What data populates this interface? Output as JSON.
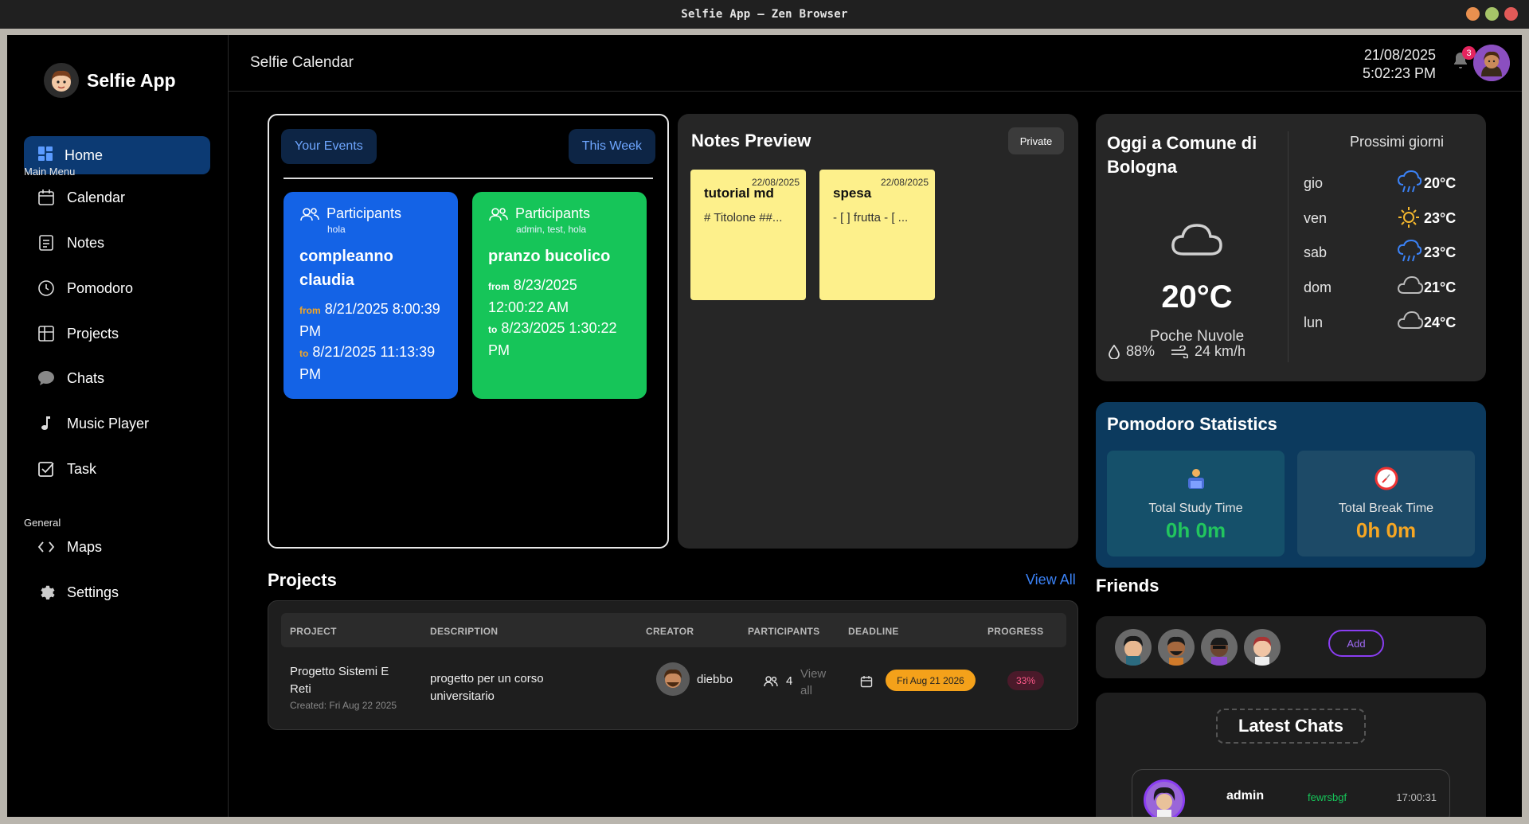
{
  "window": {
    "title": "Selfie App — Zen Browser"
  },
  "app": {
    "name": "Selfie App",
    "page_title": "Selfie Calendar"
  },
  "header": {
    "date": "21/08/2025",
    "time": "5:02:23 PM",
    "notifications": "3"
  },
  "sidebar": {
    "home": "Home",
    "main_menu_label": "Main Menu",
    "main_items": [
      {
        "label": "Calendar",
        "icon": "calendar-icon"
      },
      {
        "label": "Notes",
        "icon": "notes-icon"
      },
      {
        "label": "Pomodoro",
        "icon": "clock-icon"
      },
      {
        "label": "Projects",
        "icon": "projects-icon"
      },
      {
        "label": "Chats",
        "icon": "chat-icon"
      },
      {
        "label": "Music Player",
        "icon": "music-icon"
      },
      {
        "label": "Task",
        "icon": "task-icon"
      }
    ],
    "general_label": "General",
    "general_items": [
      {
        "label": "Maps",
        "icon": "code-icon"
      },
      {
        "label": "Settings",
        "icon": "gear-icon"
      }
    ]
  },
  "events": {
    "your_events": "Your Events",
    "this_week": "This Week",
    "items": [
      {
        "participants_label": "Participants",
        "participants": "hola",
        "title": "compleanno claudia",
        "from_label": "from",
        "from": "8/21/2025 8:00:39 PM",
        "to_label": "to",
        "to": "8/21/2025 11:13:39 PM",
        "color": "#1463e6"
      },
      {
        "participants_label": "Participants",
        "participants": "admin, test, hola",
        "title": "pranzo bucolico",
        "from_label": "from",
        "from": "8/23/2025 12:00:22 AM",
        "to_label": "to",
        "to": "8/23/2025 1:30:22 PM",
        "color": "#16c559"
      }
    ]
  },
  "notes": {
    "title": "Notes Preview",
    "filter": "Private",
    "items": [
      {
        "date": "22/08/2025",
        "title": "tutorial md",
        "preview": "# Titolone ##..."
      },
      {
        "date": "22/08/2025",
        "title": "spesa",
        "preview": "- [ ] frutta - [ ..."
      }
    ]
  },
  "weather": {
    "location": "Oggi a Comune di Bologna",
    "temp": "20°C",
    "description": "Poche Nuvole",
    "humidity": "88%",
    "wind": "24 km/h",
    "forecast_title": "Prossimi giorni",
    "forecast": [
      {
        "day": "gio",
        "temp": "20°C",
        "icon": "rain-icon"
      },
      {
        "day": "ven",
        "temp": "23°C",
        "icon": "sun-icon"
      },
      {
        "day": "sab",
        "temp": "23°C",
        "icon": "rain-icon"
      },
      {
        "day": "dom",
        "temp": "21°C",
        "icon": "cloud-icon"
      },
      {
        "day": "lun",
        "temp": "24°C",
        "icon": "cloud-icon"
      }
    ]
  },
  "pomodoro": {
    "title": "Pomodoro Statistics",
    "study_label": "Total Study Time",
    "study_value": "0h 0m",
    "break_label": "Total Break Time",
    "break_value": "0h 0m",
    "study_color": "#22c55e",
    "break_color": "#f5a623"
  },
  "friends": {
    "title": "Friends",
    "add": "Add",
    "count": 4
  },
  "chats": {
    "title": "Latest Chats",
    "items": [
      {
        "name": "admin",
        "message": "fewrsbgf",
        "time": "17:00:31"
      }
    ]
  },
  "projects": {
    "title": "Projects",
    "view_all": "View All",
    "columns": [
      "PROJECT",
      "DESCRIPTION",
      "CREATOR",
      "PARTICIPANTS",
      "DEADLINE",
      "PROGRESS"
    ],
    "rows": [
      {
        "name_line1": "Progetto Sistemi E",
        "name_line2": "Reti",
        "created": "Created: Fri Aug 22 2025",
        "desc_line1": "progetto per un corso",
        "desc_line2": "universitario",
        "creator": "diebbo",
        "participants": "4",
        "view_line1": "View",
        "view_line2": "all",
        "deadline": "Fri Aug 21 2026",
        "progress": "33%"
      }
    ]
  }
}
